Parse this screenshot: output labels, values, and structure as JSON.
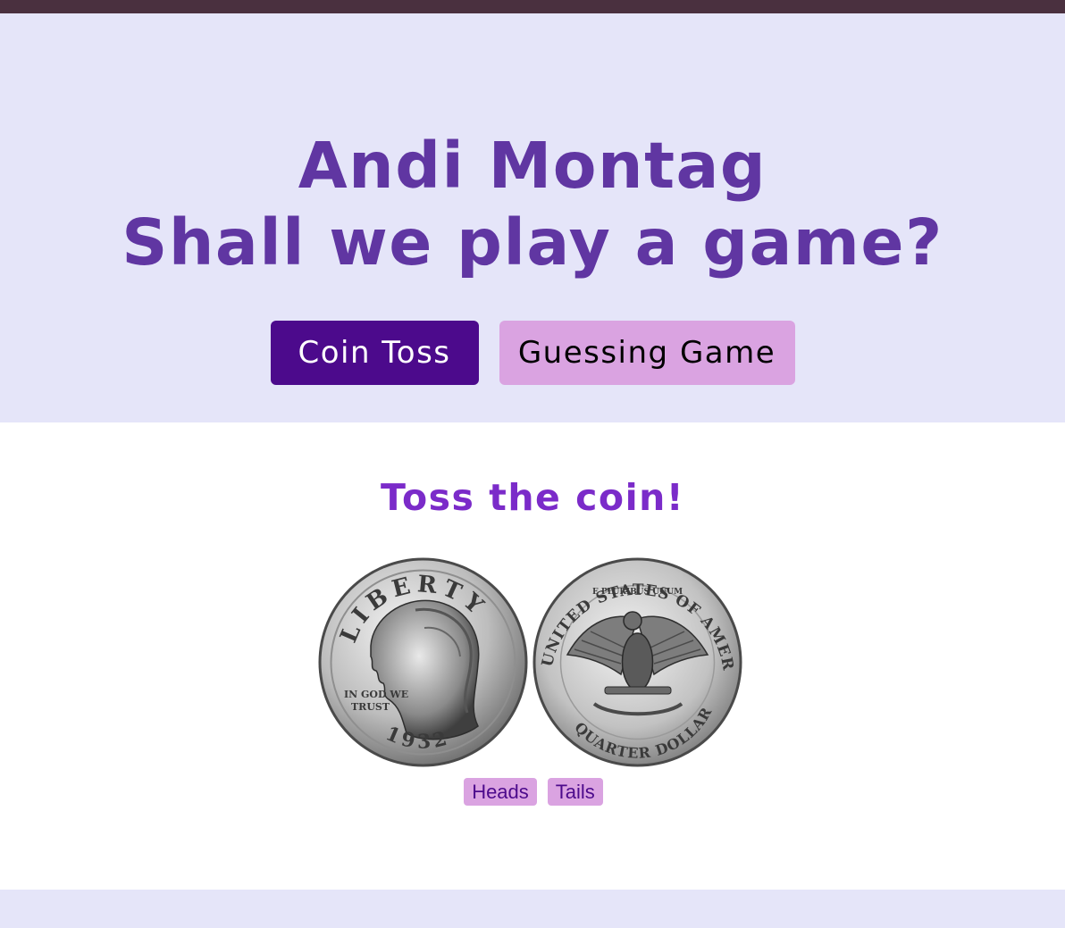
{
  "header": {
    "title_line1": "Andi Montag",
    "title_line2": "Shall we play a game?"
  },
  "nav": {
    "coin_toss_label": "Coin Toss",
    "guessing_game_label": "Guessing Game",
    "active": "Coin Toss"
  },
  "game": {
    "heading": "Toss the coin!",
    "heads_label": "Heads",
    "tails_label": "Tails",
    "coin_heads_text_top": "LIBERTY",
    "coin_heads_text_motto": "IN GOD WE TRUST",
    "coin_heads_year": "1932",
    "coin_tails_text_top": "UNITED STATES OF AMERICA",
    "coin_tails_text_motto": "E PLURIBUS UNUM",
    "coin_tails_text_bottom": "QUARTER DOLLAR"
  },
  "colors": {
    "topbar": "#4a303f",
    "hero_bg": "#e5e5f9",
    "title": "#6036a2",
    "active_button": "#4c0a8c",
    "inactive_button": "#daa3e1",
    "heading": "#7b2bc9"
  },
  "icons": {
    "heads_coin": "quarter-heads-icon",
    "tails_coin": "quarter-tails-icon"
  }
}
